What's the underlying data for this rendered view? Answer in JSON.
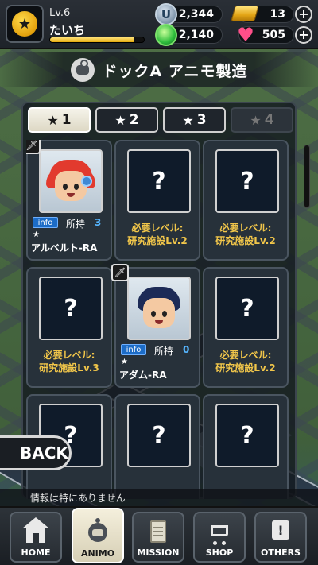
{
  "player": {
    "level": "Lv.6",
    "name": "たいち",
    "xp_fraction": 0.9
  },
  "currencies": {
    "u_coins": "2,344",
    "gold_bars": "13",
    "green_gems": "2,140",
    "hearts": "505"
  },
  "title": {
    "text": "ドックA アニモ製造"
  },
  "tabs": [
    {
      "label": "1",
      "state": "active"
    },
    {
      "label": "2",
      "state": "normal"
    },
    {
      "label": "3",
      "state": "normal"
    },
    {
      "label": "4",
      "state": "disabled"
    }
  ],
  "cards": [
    {
      "type": "owned",
      "info": "info",
      "owned_label": "所持",
      "count": "3",
      "rarity": "★",
      "name": "アルベルト-RA",
      "face": "red"
    },
    {
      "type": "locked",
      "mark": "?",
      "req_label": "必要レベル:",
      "req_value": "研究施設Lv.2"
    },
    {
      "type": "locked",
      "mark": "?",
      "req_label": "必要レベル:",
      "req_value": "研究施設Lv.2"
    },
    {
      "type": "locked",
      "mark": "?",
      "req_label": "必要レベル:",
      "req_value": "研究施設Lv.3"
    },
    {
      "type": "owned",
      "info": "info",
      "owned_label": "所持",
      "count": "0",
      "rarity": "★",
      "name": "アダム-RA",
      "face": "blue"
    },
    {
      "type": "locked",
      "mark": "?",
      "req_label": "必要レベル:",
      "req_value": "研究施設Lv.2"
    },
    {
      "type": "locked",
      "mark": "?",
      "req_label": "",
      "req_value": ""
    },
    {
      "type": "locked",
      "mark": "?",
      "req_label": "",
      "req_value": ""
    },
    {
      "type": "locked",
      "mark": "?",
      "req_label": "",
      "req_value": ""
    }
  ],
  "back_label": "BACK",
  "ticker_text": "情報は特にありません",
  "nav": [
    {
      "label": "HOME",
      "icon": "home-icon"
    },
    {
      "label": "ANIMO",
      "icon": "animo-icon"
    },
    {
      "label": "MISSION",
      "icon": "mission-icon"
    },
    {
      "label": "SHOP",
      "icon": "shop-icon"
    },
    {
      "label": "OTHERS",
      "icon": "others-icon"
    }
  ],
  "colors": {
    "requirement_text": "#f1c64a",
    "owned_count": "#56b6ff",
    "info_badge": "#1c6cc7"
  }
}
